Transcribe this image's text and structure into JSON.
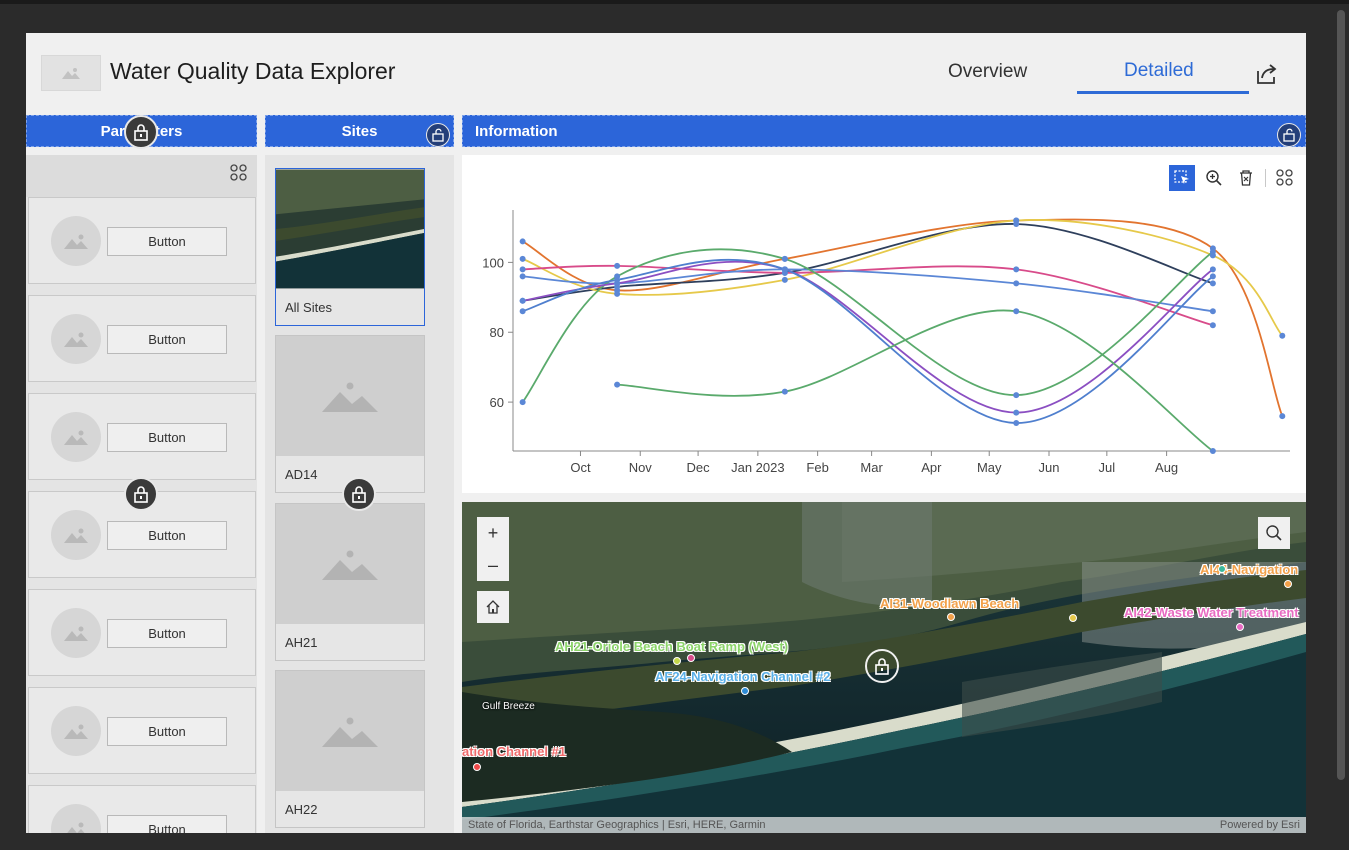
{
  "app": {
    "title": "Water Quality Data Explorer"
  },
  "tabs": [
    {
      "label": "Overview",
      "active": false
    },
    {
      "label": "Detailed",
      "active": true
    }
  ],
  "columns": {
    "parameters": "Parameters",
    "sites": "Sites",
    "information": "Information"
  },
  "parameters": {
    "items": [
      {
        "button": "Button"
      },
      {
        "button": "Button"
      },
      {
        "button": "Button"
      },
      {
        "button": "Button"
      },
      {
        "button": "Button"
      },
      {
        "button": "Button"
      },
      {
        "button": "Button"
      }
    ]
  },
  "sites": {
    "items": [
      {
        "label": "All Sites",
        "selected": true
      },
      {
        "label": "AD14",
        "selected": false
      },
      {
        "label": "AH21",
        "selected": false
      },
      {
        "label": "AH22",
        "selected": false
      }
    ]
  },
  "chart_data": {
    "type": "line",
    "x_ticks": [
      "Oct",
      "Nov",
      "Dec",
      "Jan 2023",
      "Feb",
      "Mar",
      "Apr",
      "May",
      "Jun",
      "Jul",
      "Aug"
    ],
    "y_ticks": [
      60,
      80,
      100
    ],
    "ylim": [
      46,
      115
    ],
    "series": [
      {
        "color": "#e2742f",
        "points": [
          [
            "2022-09-01",
            106
          ],
          [
            "2022-10-20",
            92
          ],
          [
            "2023-01-15",
            101
          ],
          [
            "2023-05-15",
            112
          ],
          [
            "2023-08-25",
            104
          ],
          [
            "2023-09-30",
            56
          ]
        ]
      },
      {
        "color": "#2e3f5c",
        "points": [
          [
            "2022-09-01",
            89
          ],
          [
            "2022-10-20",
            93
          ],
          [
            "2023-01-15",
            97
          ],
          [
            "2023-05-15",
            111
          ],
          [
            "2023-08-25",
            94
          ]
        ]
      },
      {
        "color": "#e6c94a",
        "points": [
          [
            "2022-09-01",
            101
          ],
          [
            "2022-10-20",
            91
          ],
          [
            "2023-01-15",
            95
          ],
          [
            "2023-05-15",
            112
          ],
          [
            "2023-08-25",
            102
          ],
          [
            "2023-09-30",
            79
          ]
        ]
      },
      {
        "color": "#d84b8a",
        "points": [
          [
            "2022-09-01",
            98
          ],
          [
            "2022-10-20",
            99
          ],
          [
            "2023-01-15",
            97
          ],
          [
            "2023-05-15",
            98
          ],
          [
            "2023-08-25",
            82
          ]
        ]
      },
      {
        "color": "#5b87d6",
        "points": [
          [
            "2022-09-01",
            96
          ],
          [
            "2022-10-20",
            94
          ],
          [
            "2023-01-15",
            98
          ],
          [
            "2023-05-15",
            94
          ],
          [
            "2023-08-25",
            86
          ]
        ]
      },
      {
        "color": "#5aaa6c",
        "points": [
          [
            "2022-09-01",
            60
          ],
          [
            "2022-10-20",
            96
          ],
          [
            "2023-01-15",
            101
          ],
          [
            "2023-05-15",
            62
          ],
          [
            "2023-08-25",
            103
          ]
        ]
      },
      {
        "color": "#8b4fc2",
        "points": [
          [
            "2022-09-01",
            89
          ],
          [
            "2022-10-20",
            94
          ],
          [
            "2023-01-15",
            98
          ],
          [
            "2023-05-15",
            57
          ],
          [
            "2023-08-25",
            98
          ]
        ]
      },
      {
        "color": "#4f7fce",
        "points": [
          [
            "2022-09-01",
            86
          ],
          [
            "2022-10-20",
            95
          ],
          [
            "2023-01-15",
            98
          ],
          [
            "2023-05-15",
            54
          ],
          [
            "2023-08-25",
            96
          ]
        ]
      },
      {
        "color": "#5aaa6c",
        "points": [
          [
            "2022-10-20",
            65
          ],
          [
            "2023-01-15",
            63
          ],
          [
            "2023-05-15",
            86
          ],
          [
            "2023-08-25",
            46
          ]
        ]
      }
    ]
  },
  "chart_tools": [
    "select-icon",
    "zoom-icon",
    "clear-selection-icon",
    "grid-icon"
  ],
  "map": {
    "controls": {
      "zoom_in": "+",
      "zoom_out": "–"
    },
    "labels": [
      {
        "text": "AI44-Navigation",
        "color": "#f2a14a"
      },
      {
        "text": "AI31-Woodlawn Beach",
        "color": "#f2a14a"
      },
      {
        "text": "AI42-Waste Water Treatment",
        "color": "#e86bc2"
      },
      {
        "text": "AH21-Oriole Beach Boat Ramp (West)",
        "color": "#8cd46a"
      },
      {
        "text": "AF24-Navigation Channel #2",
        "color": "#5ab0e8"
      },
      {
        "text": "ation Channel #1",
        "color": "#ef6a6a"
      },
      {
        "text": "Gulf Breeze",
        "color": "#ffffff"
      }
    ],
    "attribution": "State of Florida, Earthstar Geographics | Esri, HERE, Garmin",
    "powered_by": "Powered by Esri"
  }
}
